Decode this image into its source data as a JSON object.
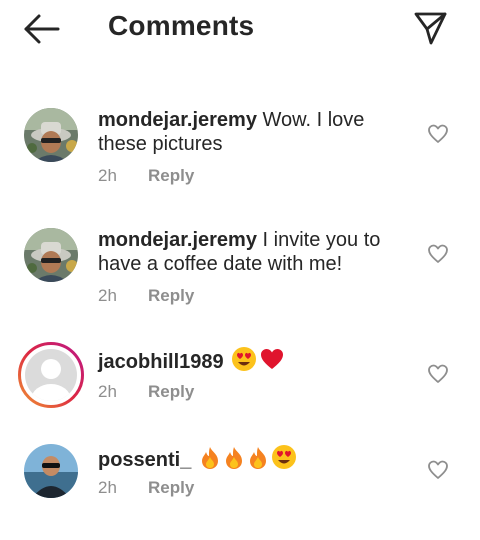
{
  "header": {
    "title": "Comments",
    "back_icon": "arrow-left-icon",
    "share_icon": "paper-plane-icon"
  },
  "comments": [
    {
      "username": "mondejar.jeremy",
      "text": " Wow. I love these pictures",
      "time": "2h",
      "reply_label": "Reply",
      "avatar": "photo-man-hat"
    },
    {
      "username": "mondejar.jeremy",
      "text": " I invite you to have a coffee date with me!",
      "time": "2h",
      "reply_label": "Reply",
      "avatar": "photo-man-hat"
    },
    {
      "username": "jacobhill1989",
      "text": "",
      "emojis": [
        "heart-eyes-emoji",
        "red-heart-emoji"
      ],
      "time": "2h",
      "reply_label": "Reply",
      "avatar": "default-avatar-with-story-ring"
    },
    {
      "username": "possenti_",
      "text": "",
      "emojis": [
        "fire-emoji",
        "fire-emoji",
        "fire-emoji",
        "heart-eyes-emoji"
      ],
      "time": "2h",
      "reply_label": "Reply",
      "avatar": "photo-man-sunglasses"
    }
  ],
  "colors": {
    "text": "#262626",
    "secondary": "#8e8e8e",
    "story_ring_start": "#f09433",
    "story_ring_end": "#bc1888",
    "heart_red": "#e0142d",
    "fire_orange": "#f58220"
  }
}
